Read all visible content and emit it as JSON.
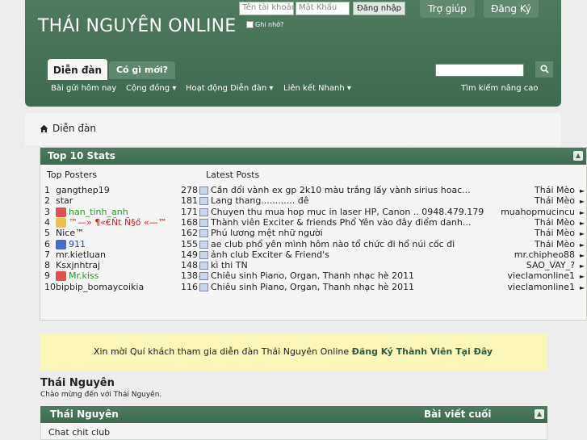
{
  "header": {
    "site_title": "THÁI NGUYÊN ONLINE",
    "username_placeholder": "Tên tài khoản",
    "password_placeholder": "Mật Khẩu",
    "login_button": "Đăng nhập",
    "remember_label": "Ghi nhớ?",
    "help_button": "Trợ giúp",
    "register_button": "Đăng Ký"
  },
  "nav": {
    "tabs": [
      "Diễn đàn",
      "Có gì mới?"
    ],
    "sub_items": [
      "Bài gửi hôm nay",
      "Cộng đồng",
      "Hoạt động Diễn đàn",
      "Liên kết Nhanh"
    ],
    "advanced_search": "Tìm kiếm nâng cao"
  },
  "breadcrumb": {
    "home": "Diễn đàn"
  },
  "stats": {
    "title": "Top 10 Stats",
    "posters_header": "Top Posters",
    "posts_header": "Latest Posts",
    "top_posters": [
      {
        "rank": "1",
        "name": "gangthep19",
        "count": "278",
        "color": "#222222"
      },
      {
        "rank": "2",
        "name": "star",
        "count": "181",
        "color": "#222222"
      },
      {
        "rank": "3",
        "name": "han_tinh_anh",
        "count": "171",
        "color": "#2d9a2d"
      },
      {
        "rank": "4",
        "name": "™—» ¶«€Ñt Ñ§ő «—™",
        "count": "168",
        "color": "#cc2222"
      },
      {
        "rank": "5",
        "name": "Nice™",
        "count": "162",
        "color": "#222222"
      },
      {
        "rank": "6",
        "name": "911",
        "count": "155",
        "color": "#2a3fbf"
      },
      {
        "rank": "7",
        "name": "mr.kietluan",
        "count": "149",
        "color": "#222222"
      },
      {
        "rank": "8",
        "name": "Ksxjnhtraj",
        "count": "148",
        "color": "#222222"
      },
      {
        "rank": "9",
        "name": "Mr.kiss",
        "count": "138",
        "color": "#2d9a2d"
      },
      {
        "rank": "10",
        "name": "bipbip_bomaycoikia",
        "count": "116",
        "color": "#222222"
      }
    ],
    "latest_posts": [
      {
        "title": "Cần đổi vành ex gp 2k10 màu trắng lấy vành sirius hoac...",
        "author": "Thái Mèo"
      },
      {
        "title": "Lang thang............ đê",
        "author": "Thái Mèo"
      },
      {
        "title": "Chuyen thu mua hop muc in laser HP, Canon .. 0948.479.179",
        "author": "muahopmucincu"
      },
      {
        "title": "Thành viên Exciter & friends Phổ Yên vào đây điểm danh...",
        "author": "Thái Mèo"
      },
      {
        "title": "Phú lương mệt nhữ người",
        "author": "Thái Mèo"
      },
      {
        "title": "ae club phổ yên mình hôm nào tổ chức đi hổ núi cốc đi",
        "author": "Thái Mèo"
      },
      {
        "title": "ảnh club Exciter & Friend's",
        "author": "mr.chipheo88"
      },
      {
        "title": "kì thi TN",
        "author": "SAO_VAY_?"
      },
      {
        "title": "Chiêu sinh Piano, Organ, Thanh nhạc hè 2011",
        "author": "vieclamonline1"
      },
      {
        "title": "Chiêu sinh Piano, Organ, Thanh nhạc hè 2011",
        "author": "vieclamonline1"
      }
    ]
  },
  "notice": {
    "text": "Xin mời Quí khách tham gia diễn đàn Thái Nguyên Online",
    "link": "Đăng Ký Thành Viên Tại Đây"
  },
  "category": {
    "title": "Thái Nguyên",
    "subtitle": "Chào mừng đến với Thái Nguyên.",
    "bar_title": "Thái Nguyên",
    "bar_last_post": "Bài viết cuối",
    "forum_row": "Chat chit club"
  },
  "colors": {
    "brand_green": "#3d6a50",
    "notice_bg": "#fbf6ba"
  },
  "icons": [
    "home-icon",
    "search-icon",
    "collapse-icon",
    "post-icon",
    "user-rank-icon",
    "dropdown-arrow-icon",
    "arrow-right-icon"
  ]
}
